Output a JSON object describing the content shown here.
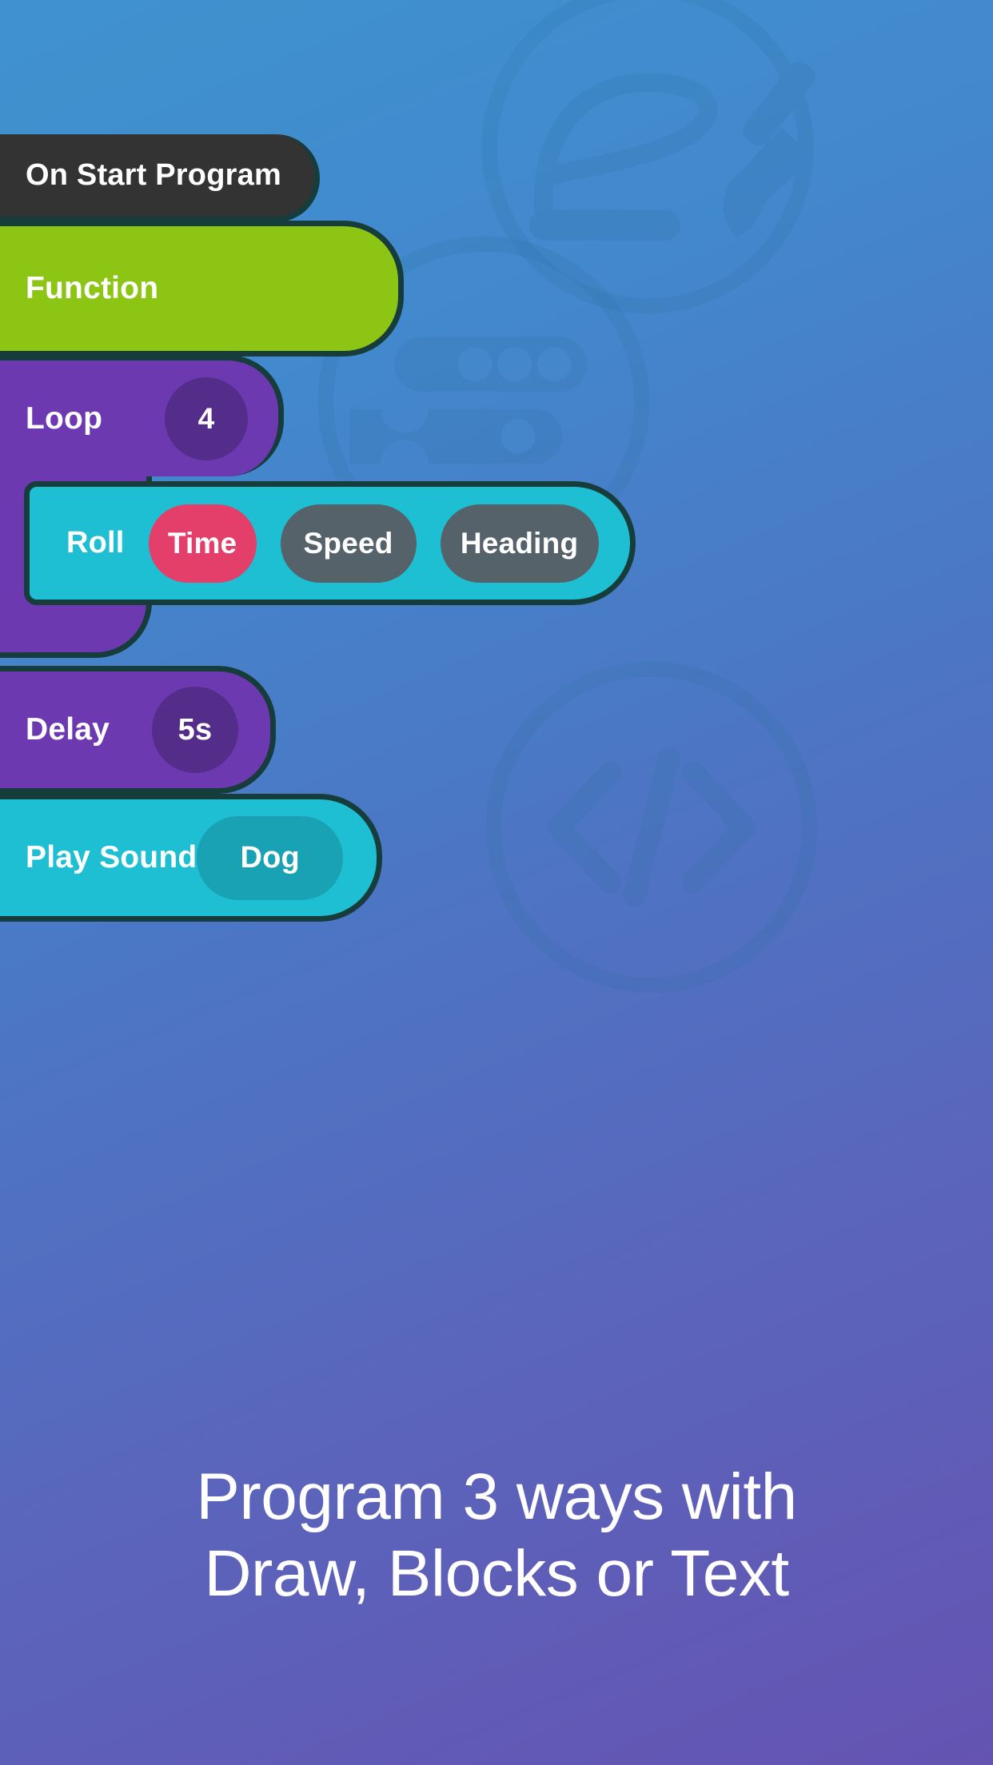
{
  "background": {
    "gradient_from": "#3f92cf",
    "gradient_to": "#6553b2",
    "watermark_icons": [
      {
        "name": "draw-icon",
        "meaning": "paintbrush drawing a line inside a circle"
      },
      {
        "name": "blocks-icon",
        "meaning": "stacked code blocks inside a circle"
      },
      {
        "name": "code-icon",
        "meaning": "angle brackets slash inside a circle"
      }
    ]
  },
  "program": {
    "blocks": [
      {
        "id": "on-start-program",
        "label": "On Start Program",
        "color": "#333333"
      },
      {
        "id": "function",
        "label": "Function",
        "color": "#8cc513"
      },
      {
        "id": "loop",
        "label": "Loop",
        "color": "#6c39b0",
        "value": "4"
      },
      {
        "id": "roll",
        "label": "Roll",
        "color": "#1ebfd3",
        "params": [
          {
            "label": "Time",
            "color": "#e33f6a"
          },
          {
            "label": "Speed",
            "color": "#566269"
          },
          {
            "label": "Heading",
            "color": "#566269"
          }
        ]
      },
      {
        "id": "delay",
        "label": "Delay",
        "color": "#6c39b0",
        "value": "5s"
      },
      {
        "id": "play-sound",
        "label": "Play Sound",
        "color": "#1ebfd3",
        "value": "Dog"
      }
    ]
  },
  "caption": {
    "line1": "Program 3 ways with",
    "line2": "Draw, Blocks or Text"
  }
}
